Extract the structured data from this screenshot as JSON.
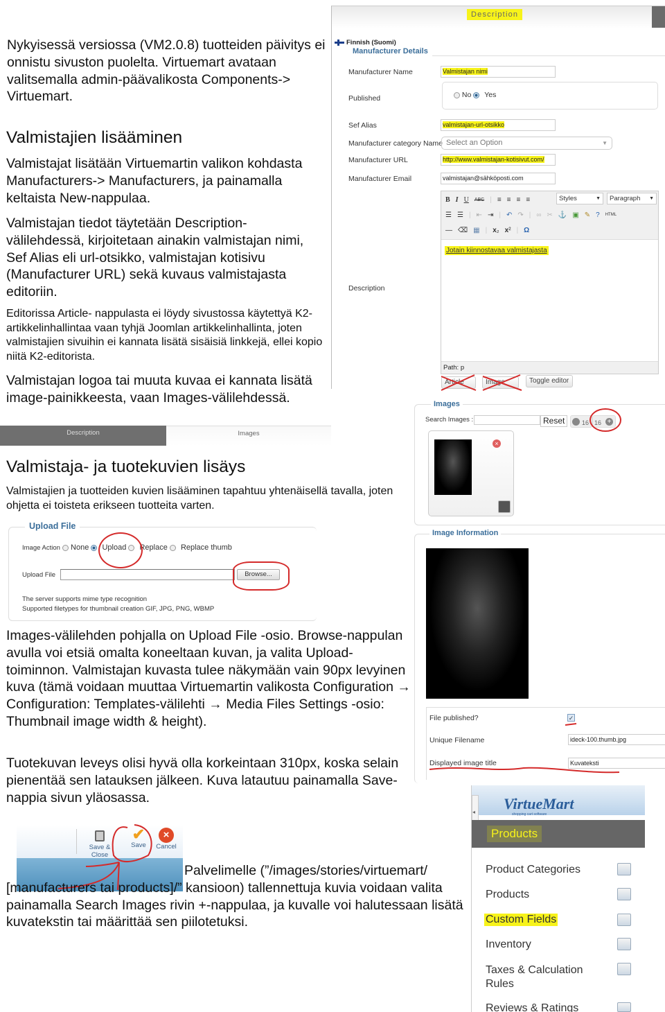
{
  "intro": {
    "paragraph": "Nykyisessä versiossa (VM2.0.8) tuotteiden päivitys ei onnistu sivuston puolelta. Virtuemart avataan valitsemalla admin-päävalikosta Components-> Virtuemart."
  },
  "section1": {
    "heading": "Valmistajien lisääminen",
    "p1": "Valmistajat lisätään Virtuemartin valikon kohdasta Manufacturers-> Manufacturers, ja painamalla keltaista New-nappulaa.",
    "p2": "Valmistajan tiedot täytetään Description-välilehdessä, kirjoitetaan ainakin valmistajan nimi, Sef Alias eli url-otsikko, valmistajan kotisivu (Manufacturer URL) sekä kuvaus valmistajasta editoriin.",
    "p3": "Editorissa Article- nappulasta ei löydy sivustossa käytettyä K2-artikkelinhallintaa vaan tyhjä Joomlan artikkelinhallinta, joten valmistajien sivuihin ei kannata lisätä sisäisiä linkkejä, ellei kopio niitä K2-editorista.",
    "p4": "Valmistajan logoa tai muuta kuvaa ei kannata lisätä image-painikkeesta, vaan Images-välilehdessä."
  },
  "manufacturer_form": {
    "tab_label": "Description",
    "language": "Finnish (Suomi)",
    "legend": "Manufacturer Details",
    "fields": {
      "name_label": "Manufacturer Name",
      "name_value": "Valmistajan nimi",
      "published_label": "Published",
      "published_no": "No",
      "published_yes": "Yes",
      "published_selected": "Yes",
      "sef_label": "Sef Alias",
      "sef_value": "valmistajan-url-otsikko",
      "category_label": "Manufacturer category Name",
      "category_value": "Select an Option",
      "url_label": "Manufacturer URL",
      "url_value": "http://www.valmistajan-kotisivut.com/",
      "email_label": "Manufacturer Email",
      "email_value": "valmistajan@sähköposti.com",
      "description_label": "Description"
    },
    "editor": {
      "styles": "Styles",
      "format": "Paragraph",
      "html_label": "HTML",
      "content": "Jotain kiinnostavaa valmistajasta",
      "path": "Path: p",
      "buttons": [
        "Article",
        "Image",
        "Toggle editor"
      ]
    }
  },
  "tabs_strip": {
    "tabs": [
      "Description",
      "Images"
    ],
    "active": "Description"
  },
  "images_panel": {
    "legend": "Images",
    "search_label": "Search Images :",
    "search_value": "",
    "reset_label": "Reset",
    "count_minus": "16",
    "count_plus": "16"
  },
  "section2": {
    "heading": "Valmistaja- ja tuotekuvien lisäys",
    "p1": "Valmistajien ja tuotteiden kuvien lisääminen tapahtuu yhtenäisellä tavalla, joten ohjetta ei toisteta erikseen tuotteita varten.",
    "p2": "Images-välilehden pohjalla on Upload File -osio. Browse-nappulan avulla voi etsiä omalta koneeltaan kuvan, ja valita Upload-toiminnon. Valmistajan kuvasta tulee näkymään vain 90px levyinen kuva (tämä voidaan muuttaa Virtuemartin valikosta Configuration → Configuration: Templates-välilehti → Media Files Settings -osio: Thumbnail image width & height).",
    "p3": "Tuotekuvan leveys olisi hyvä olla korkeintaan 310px, koska selain pienentää sen latauksen jälkeen. Kuva latautuu painamalla Save-nappia sivun yläosassa.",
    "p4": "Palvelimelle (”/images/stories/virtuemart/ [manufacturers tai products]/” kansioon) tallennettuja kuvia voidaan valita painamalla Search Images rivin +-nappulaa, ja kuvalle voi halutessaan lisätä kuvatekstin tai määrittää sen piilotetuksi."
  },
  "upload_panel": {
    "legend": "Upload File",
    "action_label": "Image Action",
    "options": [
      "None",
      "Upload",
      "Replace",
      "Replace thumb"
    ],
    "selected": "Upload",
    "file_label": "Upload File",
    "file_value": "",
    "browse_label": "Browse...",
    "note1": "The server supports mime type recognition",
    "note2": "Supported filetypes for thumbnail creation GIF, JPG, PNG, WBMP"
  },
  "image_info": {
    "legend": "Image Information",
    "published_label": "File published?",
    "published_checked": true,
    "filename_label": "Unique Filename",
    "filename_value": "ideck-100.thumb.jpg",
    "title_label": "Displayed image title",
    "title_value": "Kuvateksti"
  },
  "save_toolbar": {
    "buttons": [
      "Save & Close",
      "Save",
      "Cancel"
    ]
  },
  "vm_menu": {
    "logo": "VirtueMart",
    "logo_tagline": "shopping cart software",
    "section": "Products",
    "items": [
      "Product Categories",
      "Products",
      "Custom Fields",
      "Inventory",
      "Taxes & Calculation Rules",
      "Reviews & Ratings"
    ],
    "highlighted": "Custom Fields"
  },
  "colors": {
    "highlight": "#f7f31a",
    "annotation_red": "#d42a2a",
    "legend_blue": "#3b6e9a",
    "tab_dark": "#6f6f6f"
  }
}
